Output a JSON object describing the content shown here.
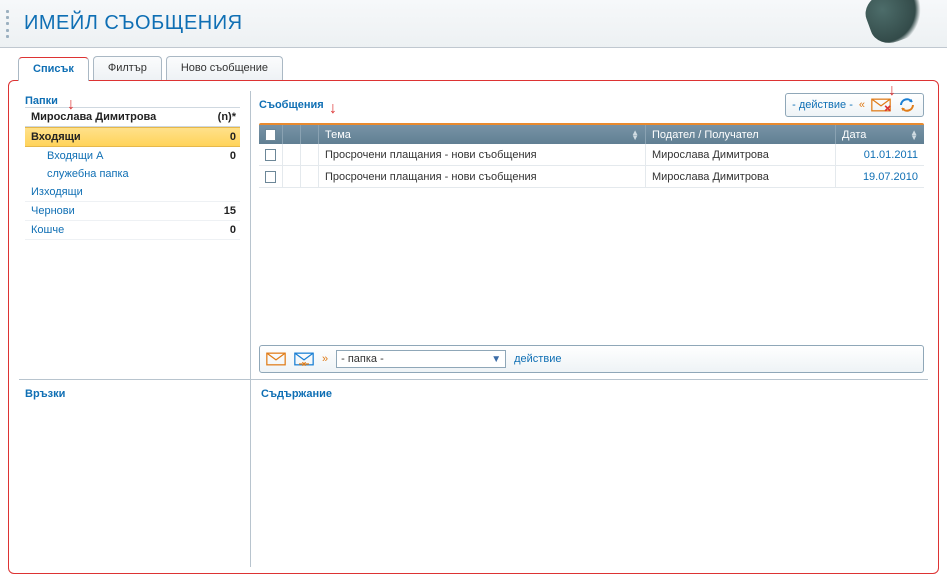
{
  "page_title": "ИМЕЙЛ СЪОБЩЕНИЯ",
  "tabs": [
    {
      "label": "Списък",
      "active": true
    },
    {
      "label": "Филтър",
      "active": false
    },
    {
      "label": "Ново съобщение",
      "active": false
    }
  ],
  "folders": {
    "title": "Папки",
    "count_header": "(n)*",
    "user": "Мирослава Димитрова",
    "items": [
      {
        "name": "Входящи",
        "count": "0",
        "selected": true
      },
      {
        "name": "Входящи А",
        "count": "0",
        "sub": true
      },
      {
        "name": "служебна папка",
        "count": "",
        "sub": true,
        "nocount": true
      },
      {
        "name": "Изходящи",
        "count": "",
        "nocount": true
      },
      {
        "name": "Чернови",
        "count": "15"
      },
      {
        "name": "Кошче",
        "count": "0"
      }
    ]
  },
  "messages": {
    "title": "Съобщения",
    "action_placeholder": "- действие -",
    "columns": {
      "subject": "Тема",
      "sender": "Подател / Получател",
      "date": "Дата"
    },
    "rows": [
      {
        "subject": "Просрочени плащания - нови съобщения",
        "sender": "Мирослава Димитрова",
        "date": "01.01.2011"
      },
      {
        "subject": "Просрочени плащания - нови съобщения",
        "sender": "Мирослава Димитрова",
        "date": "19.07.2010"
      }
    ],
    "footer": {
      "folder_select": "- папка -",
      "action_label": "действие"
    }
  },
  "links_title": "Връзки",
  "content_title": "Съдържание"
}
